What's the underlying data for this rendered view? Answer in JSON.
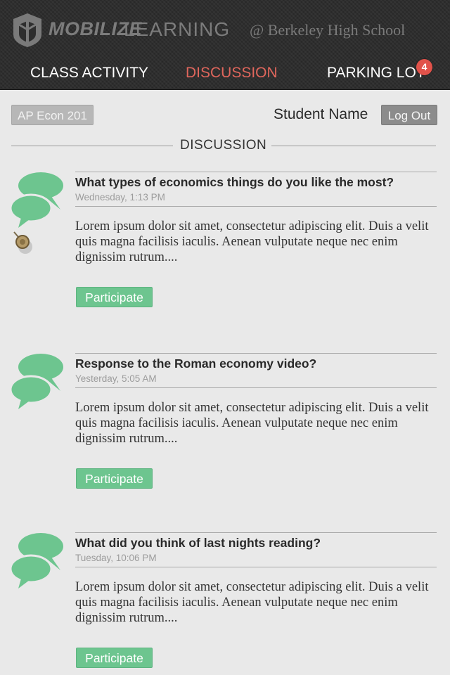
{
  "header": {
    "brand_bold": "MOBILIZE",
    "brand_light": "LEARNING",
    "school": "@ Berkeley High School",
    "logo_icon": "shield-logo-icon",
    "tabs": [
      {
        "label": "CLASS ACTIVITY",
        "active": false
      },
      {
        "label": "DISCUSSION",
        "active": true
      },
      {
        "label": "PARKING LOT",
        "active": false
      }
    ],
    "parking_badge": "4"
  },
  "toolbar": {
    "course": "AP Econ 201",
    "student_name": "Student Name",
    "logout": "Log Out"
  },
  "section_title": "DISCUSSION",
  "posts": [
    {
      "title": "What types of economics things do you like the most?",
      "time": "Wednesday, 1:13 PM",
      "body": "Lorem ipsum dolor sit amet, consectetur adipiscing elit. Duis a velit quis magna facilisis iaculis. Aenean vulputate neque nec enim dignissim rutrum....",
      "button": "Participate",
      "pinned": true
    },
    {
      "title": "Response to the Roman economy video?",
      "time": "Yesterday, 5:05 AM",
      "body": "Lorem ipsum dolor sit amet, consectetur adipiscing elit. Duis a velit quis magna facilisis iaculis. Aenean vulputate neque nec enim dignissim rutrum....",
      "button": "Participate",
      "pinned": false
    },
    {
      "title": "What did you think of last nights reading?",
      "time": "Tuesday, 10:06 PM",
      "body": "Lorem ipsum dolor sit amet, consectetur adipiscing elit. Duis a velit quis magna facilisis iaculis. Aenean vulputate neque nec enim dignissim rutrum....",
      "button": "Participate",
      "pinned": false
    }
  ],
  "colors": {
    "accent_active": "#e0665c",
    "participate": "#6dc58f",
    "bubble": "#6dc58f",
    "badge": "#e1524a"
  }
}
